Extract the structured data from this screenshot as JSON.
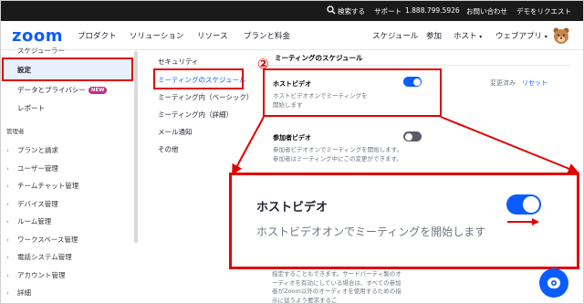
{
  "topbar": {
    "search_label": "検索する",
    "support_label": "サポート",
    "phone": "1.888.799.5926",
    "contact_label": "お問い合わせ",
    "demo_label": "デモをリクエスト"
  },
  "navbar": {
    "logo": "zoom",
    "left_items": [
      "プロダクト",
      "ソリューション",
      "リソース",
      "プランと料金"
    ],
    "right_items": [
      "スケジュール",
      "参加",
      "ホスト",
      "ウェブアプリ"
    ]
  },
  "sidebar": {
    "top_cut_label": "スケジューラー",
    "active_label": "設定",
    "privacy_label": "データとプライバシー",
    "new_badge": "NEW",
    "report_label": "レポート",
    "admin_header": "管理者",
    "admin_items": [
      "プランと請求",
      "ユーザー管理",
      "チームチャット管理",
      "デバイス管理",
      "ルーム管理",
      "ワークスペース管理",
      "電話システム管理",
      "アカウント管理",
      "詳細"
    ]
  },
  "subnav": {
    "items": [
      "セキュリティ",
      "ミーティングのスケジュール",
      "ミーティング内（ベーシック）",
      "ミーティング内（詳細）",
      "メール通知",
      "その他"
    ],
    "active_index": 1
  },
  "content": {
    "section_title": "ミーティングのスケジュール",
    "host_video_title": "ホストビデオ",
    "host_video_desc": "ホストビデオオンでミーティングを開始します",
    "host_video_enabled": true,
    "modified_label": "変更済み",
    "reset_label": "リセット",
    "participant_video_title": "参加者ビデオ",
    "participant_video_desc": "参加者ビデオオンでミーティングを開始します。参加者はミーティング中にこの変更ができます。",
    "participant_video_enabled": false,
    "bottom_desc": "指定することもできます。サードパーティ製のオーディオを有効にしている場合は、すべての参加者がZoom以外のオーディオを使用するための指示に従うよう要求するこ"
  },
  "annotation": {
    "step_marker": "②"
  },
  "callout": {
    "title": "ホストビデオ",
    "desc": "ホストビデオオンでミーティングを開始します",
    "enabled": true
  },
  "colors": {
    "accent": "#0b5cff",
    "annotation_red": "#e00000",
    "toggle_off": "#5c5c66",
    "top_bar": "#1a1a1a"
  }
}
